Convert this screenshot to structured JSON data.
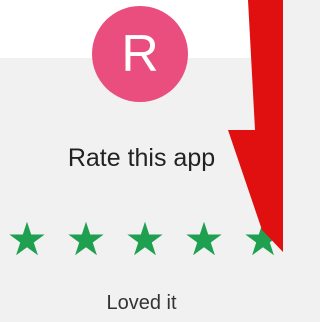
{
  "avatar": {
    "letter": "R",
    "color": "#e94e7e"
  },
  "dialog": {
    "title": "Rate this app",
    "caption": "Loved it"
  },
  "rating": {
    "value": 5,
    "max": 5,
    "star_color": "#1ea050",
    "star_glyph": "★"
  },
  "overlay": {
    "arrow_color": "#e01010",
    "icon": "arrow-down-icon"
  }
}
